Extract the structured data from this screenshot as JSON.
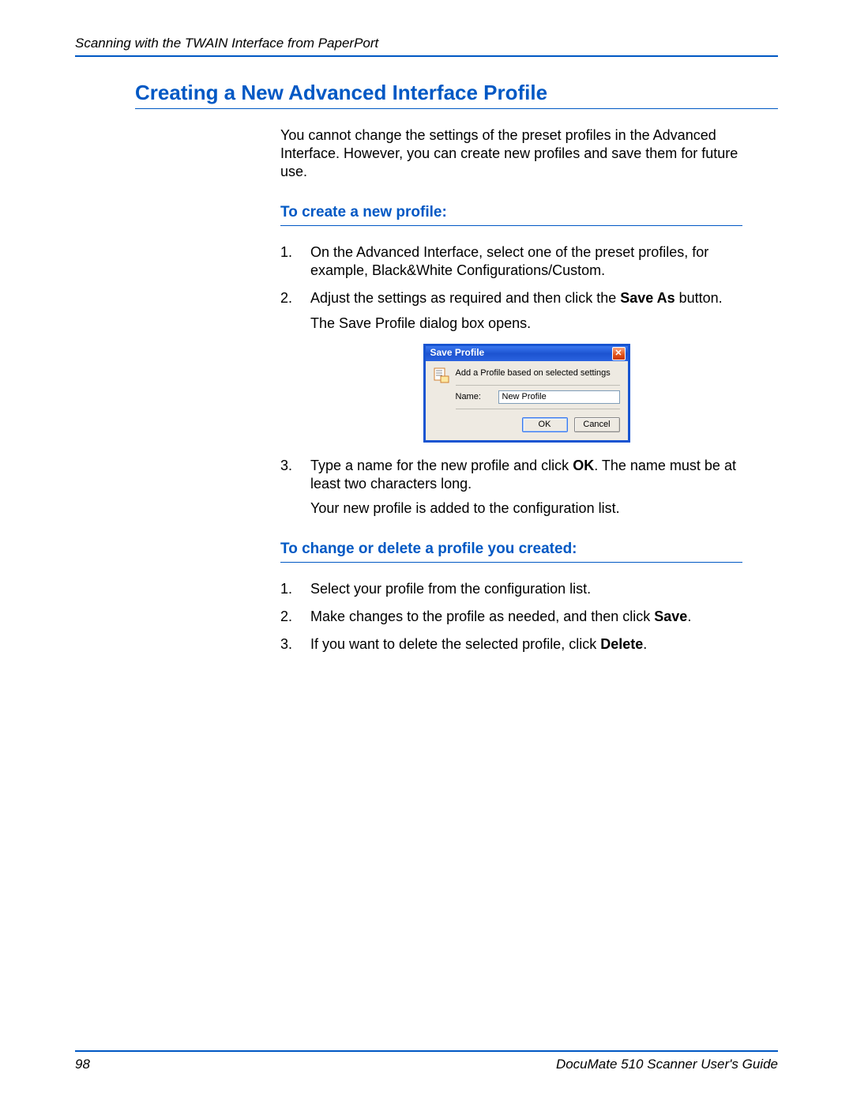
{
  "header": {
    "breadcrumb": "Scanning with the TWAIN Interface from PaperPort"
  },
  "section": {
    "title": "Creating a New Advanced Interface Profile",
    "intro": "You cannot change the settings of the preset profiles in the Advanced Interface. However, you can create new profiles and save them for future use.",
    "subhead_create": "To create a new profile:",
    "steps_create": {
      "s1": "On the Advanced Interface, select one of the preset profiles, for example, Black&White Configurations/Custom.",
      "s2a": "Adjust the settings as required and then click the ",
      "s2_bold": "Save As",
      "s2b": " button.",
      "s2_sub": "The Save Profile dialog box opens.",
      "s3a": "Type a name for the new profile and click ",
      "s3_bold": "OK",
      "s3b": ". The name must be at least two characters long.",
      "s3_sub": "Your new profile is added to the configuration list."
    },
    "subhead_change": "To change or delete a profile you created:",
    "steps_change": {
      "s1": "Select your profile from the configuration list.",
      "s2a": "Make changes to the profile as needed, and then click ",
      "s2_bold": "Save",
      "s2b": ".",
      "s3a": "If you want to delete the selected profile, click ",
      "s3_bold": "Delete",
      "s3b": "."
    }
  },
  "dialog": {
    "title": "Save Profile",
    "description": "Add a Profile based on selected settings",
    "name_label": "Name:",
    "name_value": "New Profile",
    "ok_label": "OK",
    "cancel_label": "Cancel"
  },
  "footer": {
    "page_number": "98",
    "guide_name": "DocuMate 510 Scanner User's Guide"
  }
}
